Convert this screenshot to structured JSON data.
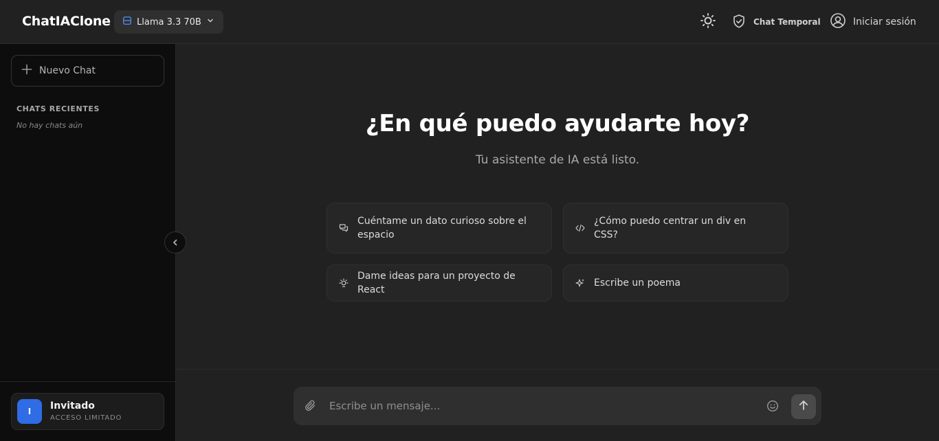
{
  "header": {
    "brand": "ChatIAClone",
    "model_label": "Llama 3.3 70B",
    "temp_chat_label": "Chat Temporal",
    "login_label": "Iniciar sesión"
  },
  "sidebar": {
    "new_chat_label": "Nuevo Chat",
    "recent_title": "CHATS RECIENTES",
    "empty_text": "No hay chats aún",
    "user": {
      "avatar_initial": "I",
      "name": "Invitado",
      "status": "ACCESO LIMITADO"
    }
  },
  "main": {
    "title": "¿En qué puedo ayudarte hoy?",
    "subtitle": "Tu asistente de IA está listo.",
    "suggestions": [
      {
        "label": "Cuéntame un dato curioso sobre el espacio",
        "icon": "chat-bubbles-icon"
      },
      {
        "label": "¿Cómo puedo centrar un div en CSS?",
        "icon": "code-icon"
      },
      {
        "label": "Dame ideas para un proyecto de React",
        "icon": "lightbulb-icon"
      },
      {
        "label": "Escribe un poema",
        "icon": "sparkles-icon"
      }
    ],
    "composer": {
      "placeholder": "Escribe un mensaje..."
    }
  },
  "colors": {
    "background": "#212121",
    "sidebar": "#0d0d0d",
    "card": "#262626",
    "accent": "#2f6ce5",
    "model_icon": "#4f8ff7"
  }
}
